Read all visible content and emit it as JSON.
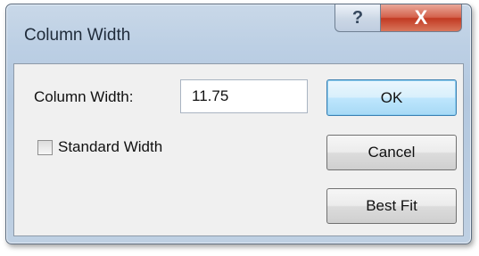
{
  "window": {
    "title": "Column Width",
    "help_glyph": "?",
    "close_glyph": "X"
  },
  "form": {
    "column_width_label": "Column Width:",
    "column_width_value": "11.75",
    "standard_width_label": "Standard Width",
    "standard_width_checked": false
  },
  "buttons": {
    "ok": "OK",
    "cancel": "Cancel",
    "best_fit": "Best Fit"
  },
  "colors": {
    "title_bar": "#bccfe4",
    "close_button": "#c9452c",
    "ok_button_border": "#3c7fb1"
  }
}
